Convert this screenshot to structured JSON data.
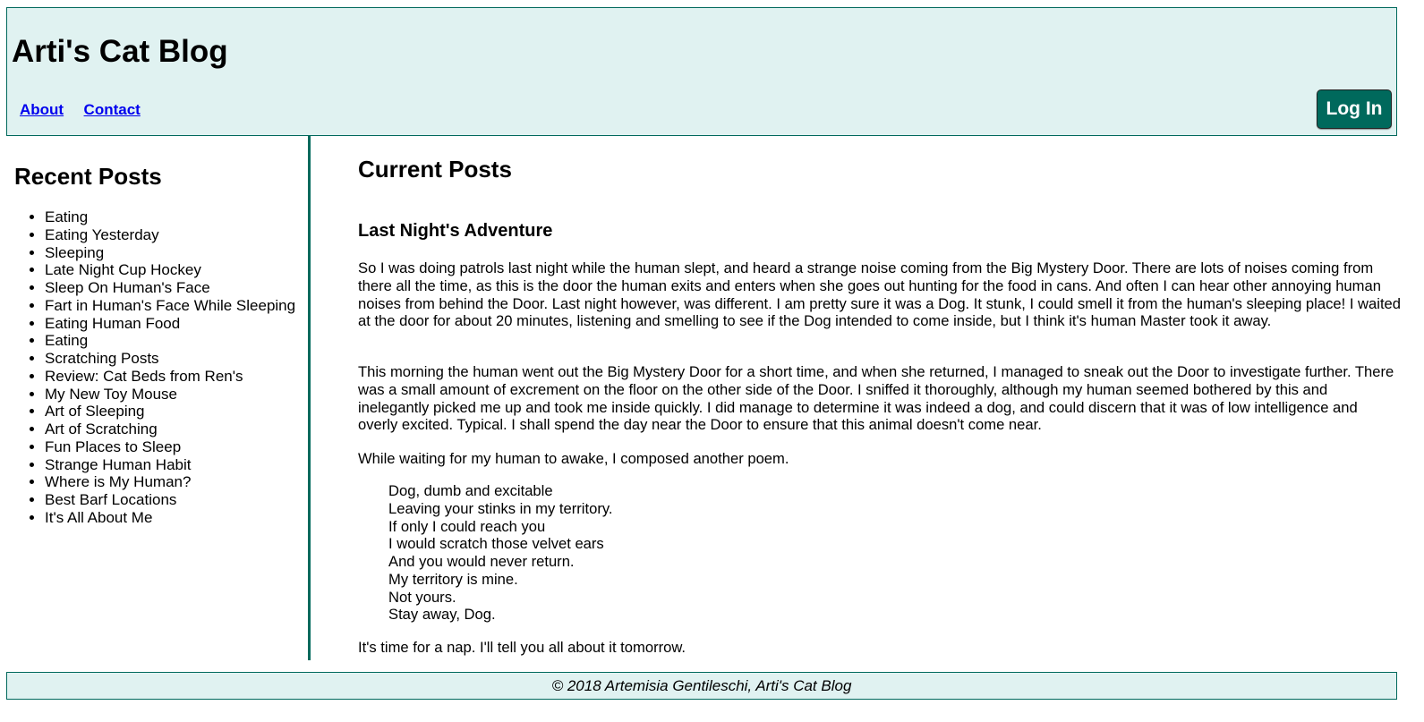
{
  "header": {
    "title": "Arti's Cat Blog",
    "nav": [
      {
        "label": "About"
      },
      {
        "label": "Contact"
      }
    ],
    "login_label": "Log In"
  },
  "sidebar": {
    "heading": "Recent Posts",
    "items": [
      "Eating",
      "Eating Yesterday",
      "Sleeping",
      "Late Night Cup Hockey",
      "Sleep On Human's Face",
      "Fart in Human's Face While Sleeping",
      "Eating Human Food",
      "Eating",
      "Scratching Posts",
      "Review: Cat Beds from Ren's",
      "My New Toy Mouse",
      "Art of Sleeping",
      "Art of Scratching",
      "Fun Places to Sleep",
      "Strange Human Habit",
      "Where is My Human?",
      "Best Barf Locations",
      "It's All About Me"
    ]
  },
  "main": {
    "heading": "Current Posts",
    "post": {
      "title": "Last Night's Adventure",
      "paragraphs": [
        "So I was doing patrols last night while the human slept, and heard a strange noise coming from the Big Mystery Door. There are lots of noises coming from there all the time, as this is the door the human exits and enters when she goes out hunting for the food in cans. And often I can hear other annoying human noises from behind the Door. Last night however, was different. I am pretty sure it was a Dog. It stunk, I could smell it from the human's sleeping place! I waited at the door for about 20 minutes, listening and smelling to see if the Dog intended to come inside, but I think it's human Master took it away.",
        "This morning the human went out the Big Mystery Door for a short time, and when she returned, I managed to sneak out the Door to investigate further. There was a small amount of excrement on the floor on the other side of the Door. I sniffed it thoroughly, although my human seemed bothered by this and inelegantly picked me up and took me inside quickly. I did manage to determine it was indeed a dog, and could discern that it was of low intelligence and overly excited. Typical. I shall spend the day near the Door to ensure that this animal doesn't come near.",
        "While waiting for my human to awake, I composed another poem."
      ],
      "poem": [
        "Dog, dumb and excitable",
        "Leaving your stinks in my territory.",
        "If only I could reach you",
        "I would scratch those velvet ears",
        "And you would never return.",
        "My territory is mine.",
        "Not yours.",
        "Stay away, Dog."
      ],
      "closing": "It's time for a nap. I'll tell you all about it tomorrow."
    }
  },
  "footer": {
    "text": "© 2018 Artemisia Gentileschi, Arti's Cat Blog"
  },
  "colors": {
    "accent": "#00695c",
    "header_bg": "#e0f2f1",
    "link": "#0000ee"
  }
}
